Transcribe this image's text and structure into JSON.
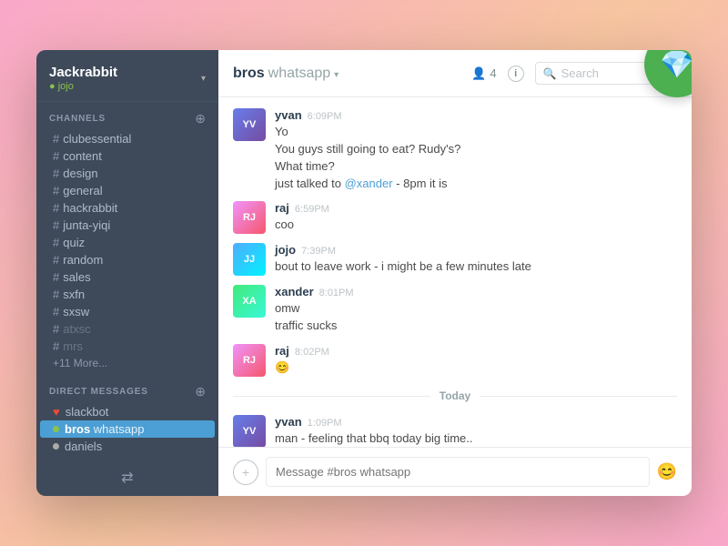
{
  "app": {
    "title": "Jackrabbit",
    "user_status": "jojo",
    "sketch_badge_label": "💎"
  },
  "sidebar": {
    "workspace": "Jackrabbit",
    "user": "jojo",
    "channels_label": "CHANNELS",
    "channels": [
      {
        "name": "clubessential"
      },
      {
        "name": "content"
      },
      {
        "name": "design"
      },
      {
        "name": "general"
      },
      {
        "name": "hackrabbit"
      },
      {
        "name": "junta-yiqi"
      },
      {
        "name": "quiz"
      },
      {
        "name": "random"
      },
      {
        "name": "sales"
      },
      {
        "name": "sxfn"
      },
      {
        "name": "sxsw"
      },
      {
        "name": "atxsc",
        "muted": true
      },
      {
        "name": "mrs",
        "muted": true
      }
    ],
    "more_label": "+11 More...",
    "dm_label": "DIRECT MESSAGES",
    "dm_items": [
      {
        "name": "slackbot",
        "status": "online",
        "heart": true
      },
      {
        "name": "bros",
        "extra": "whatsapp",
        "status": "online",
        "active": true
      },
      {
        "name": "daniels",
        "status": "away"
      }
    ]
  },
  "header": {
    "channel_bold": "bros",
    "channel_light": "whatsapp",
    "member_count": "4",
    "search_placeholder": "Search"
  },
  "messages": [
    {
      "id": "m1",
      "author": "yvan",
      "time": "6:09PM",
      "lines": [
        "Yo",
        "You guys still going to eat? Rudy's?",
        "What time?",
        "just talked to @xander - 8pm it is"
      ],
      "mention": "@xander"
    },
    {
      "id": "m2",
      "author": "raj",
      "time": "6:59PM",
      "lines": [
        "coo"
      ]
    },
    {
      "id": "m3",
      "author": "jojo",
      "time": "7:39PM",
      "lines": [
        "bout to leave work - i might be a few minutes late"
      ]
    },
    {
      "id": "m4",
      "author": "xander",
      "time": "8:01PM",
      "lines": [
        "omw",
        "traffic sucks"
      ]
    },
    {
      "id": "m5",
      "author": "raj",
      "time": "8:02PM",
      "lines": [
        "😊"
      ]
    }
  ],
  "today_divider": "Today",
  "today_messages": [
    {
      "id": "tm1",
      "author": "yvan",
      "time": "1:09PM",
      "lines": [
        "man - feeling that bbq today big time.."
      ]
    }
  ],
  "input": {
    "placeholder": "Message #bros whatsapp"
  }
}
